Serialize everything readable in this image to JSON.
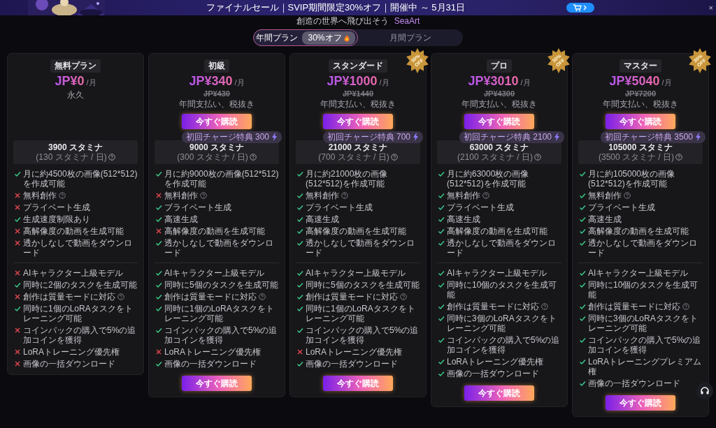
{
  "banner": {
    "text": "ファイナルセール｜SVIP期間限定30%オフ｜開催中 ～ 5月31日",
    "close": "×"
  },
  "tagline": {
    "text": "創造の世界へ飛び出そう",
    "brand": "SeaArt"
  },
  "billing_toggle": [
    {
      "label": "年間プラン",
      "selected": true,
      "badge": "30%オフ"
    },
    {
      "label": "月間プラン",
      "selected": false
    }
  ],
  "plans": [
    {
      "name": "無料プラン",
      "price": "JP¥0",
      "per": "/月",
      "note": "永久",
      "stamina": "3900 スタミナ",
      "stamina_daily": "(130 スタミナ / 日)",
      "feature_groups": [
        [
          {
            "text": "月に約4500枚の画像(512*512)を作成可能",
            "included": true
          },
          {
            "text": "無料創作",
            "included": false,
            "help": true
          },
          {
            "text": "プライベート生成",
            "included": false
          },
          {
            "text": "生成速度制限あり",
            "included": true
          },
          {
            "text": "高解像度の動画を生成可能",
            "included": false
          },
          {
            "text": "透かしなしで動画をダウンロード",
            "included": false
          }
        ],
        [
          {
            "text": "AIキャラクター上級モデル",
            "included": false
          },
          {
            "text": "同時に2個のタスクを生成可能",
            "included": true
          },
          {
            "text": "創作は質量モードに対応",
            "included": false,
            "help": true
          },
          {
            "text": "同時に1個のLoRAタスクをトレーニング可能",
            "included": true
          },
          {
            "text": "コインパックの購入で5%の追加コインを獲得",
            "included": false
          },
          {
            "text": "LoRAトレーニング優先権",
            "included": false
          },
          {
            "text": "画像の一括ダウンロード",
            "included": false
          }
        ]
      ]
    },
    {
      "name": "初級",
      "price": "JP¥340",
      "per": "/月",
      "old_price": "JP¥430",
      "note": "年間支払い、税抜き",
      "buy_button": "今すぐ購読",
      "stamina": "9000 スタミナ",
      "stamina_daily": "(300 スタミナ / 日)",
      "bonus": "初回チャージ特典 300",
      "feature_groups": [
        [
          {
            "text": "月に約9000枚の画像(512*512)を作成可能",
            "included": true
          },
          {
            "text": "無料創作",
            "included": false,
            "help": true
          },
          {
            "text": "プライベート生成",
            "included": true
          },
          {
            "text": "高速生成",
            "included": true
          },
          {
            "text": "高解像度の動画を生成可能",
            "included": false
          },
          {
            "text": "透かしなしで動画をダウンロード",
            "included": true
          }
        ],
        [
          {
            "text": "AIキャラクター上級モデル",
            "included": true
          },
          {
            "text": "同時に5個のタスクを生成可能",
            "included": true
          },
          {
            "text": "創作は質量モードに対応",
            "included": true,
            "help": true
          },
          {
            "text": "同時に1個のLoRAタスクをトレーニング可能",
            "included": true
          },
          {
            "text": "コインパックの購入で5%の追加コインを獲得",
            "included": true
          },
          {
            "text": "LoRAトレーニング優先権",
            "included": false
          },
          {
            "text": "画像の一括ダウンロード",
            "included": true
          }
        ]
      ],
      "bottom_button": "今すぐ購読"
    },
    {
      "name": "スタンダード",
      "discount_badge": "30% OFF",
      "price": "JP¥1000",
      "per": "/月",
      "old_price": "JP¥1440",
      "note": "年間支払い、税抜き",
      "buy_button": "今すぐ購読",
      "stamina": "21000 スタミナ",
      "stamina_daily": "(700 スタミナ / 日)",
      "bonus": "初回チャージ特典 700",
      "feature_groups": [
        [
          {
            "text": "月に約21000枚の画像(512*512)を作成可能",
            "included": true
          },
          {
            "text": "無料創作",
            "included": true,
            "help": true
          },
          {
            "text": "プライベート生成",
            "included": true
          },
          {
            "text": "高速生成",
            "included": true
          },
          {
            "text": "高解像度の動画を生成可能",
            "included": true
          },
          {
            "text": "透かしなしで動画をダウンロード",
            "included": true
          }
        ],
        [
          {
            "text": "AIキャラクター上級モデル",
            "included": true
          },
          {
            "text": "同時に5個のタスクを生成可能",
            "included": true
          },
          {
            "text": "創作は質量モードに対応",
            "included": true,
            "help": true
          },
          {
            "text": "同時に1個のLoRAタスクをトレーニング可能",
            "included": true
          },
          {
            "text": "コインパックの購入で5%の追加コインを獲得",
            "included": true
          },
          {
            "text": "LoRAトレーニング優先権",
            "included": false
          },
          {
            "text": "画像の一括ダウンロード",
            "included": true
          }
        ]
      ],
      "bottom_button": "今すぐ購読"
    },
    {
      "name": "プロ",
      "discount_badge": "30% OFF",
      "price": "JP¥3010",
      "per": "/月",
      "old_price": "JP¥4300",
      "note": "年間支払い、税抜き",
      "buy_button": "今すぐ購読",
      "stamina": "63000 スタミナ",
      "stamina_daily": "(2100 スタミナ / 日)",
      "bonus": "初回チャージ特典 2100",
      "feature_groups": [
        [
          {
            "text": "月に約63000枚の画像(512*512)を作成可能",
            "included": true
          },
          {
            "text": "無料創作",
            "included": true,
            "help": true
          },
          {
            "text": "プライベート生成",
            "included": true
          },
          {
            "text": "高速生成",
            "included": true
          },
          {
            "text": "高解像度の動画を生成可能",
            "included": true
          },
          {
            "text": "透かしなしで動画をダウンロード",
            "included": true
          }
        ],
        [
          {
            "text": "AIキャラクター上級モデル",
            "included": true
          },
          {
            "text": "同時に10個のタスクを生成可能",
            "included": true
          },
          {
            "text": "創作は質量モードに対応",
            "included": true,
            "help": true
          },
          {
            "text": "同時に3個のLoRAタスクをトレーニング可能",
            "included": true
          },
          {
            "text": "コインパックの購入で5%の追加コインを獲得",
            "included": true
          },
          {
            "text": "LoRAトレーニング優先権",
            "included": true
          },
          {
            "text": "画像の一括ダウンロード",
            "included": true
          }
        ]
      ],
      "bottom_button": "今すぐ購読"
    },
    {
      "name": "マスター",
      "discount_badge": "30% OFF",
      "price": "JP¥5040",
      "per": "/月",
      "old_price": "JP¥7200",
      "note": "年間支払い、税抜き",
      "buy_button": "今すぐ購読",
      "stamina": "105000 スタミナ",
      "stamina_daily": "(3500 スタミナ / 日)",
      "bonus": "初回チャージ特典 3500",
      "feature_groups": [
        [
          {
            "text": "月に約105000枚の画像(512*512)を作成可能",
            "included": true
          },
          {
            "text": "無料創作",
            "included": true,
            "help": true
          },
          {
            "text": "プライベート生成",
            "included": true
          },
          {
            "text": "高速生成",
            "included": true
          },
          {
            "text": "高解像度の動画を生成可能",
            "included": true
          },
          {
            "text": "透かしなしで動画をダウンロード",
            "included": true
          }
        ],
        [
          {
            "text": "AIキャラクター上級モデル",
            "included": true
          },
          {
            "text": "同時に10個のタスクを生成可能",
            "included": true
          },
          {
            "text": "創作は質量モードに対応",
            "included": true,
            "help": true
          },
          {
            "text": "同時に3個のLoRAタスクをトレーニング可能",
            "included": true
          },
          {
            "text": "コインパックの購入で5%の追加コインを獲得",
            "included": true
          },
          {
            "text": "LoRAトレーニングプレミアム権",
            "included": true
          },
          {
            "text": "画像の一括ダウンロード",
            "included": true
          }
        ]
      ],
      "bottom_button": "今すぐ購読"
    }
  ]
}
